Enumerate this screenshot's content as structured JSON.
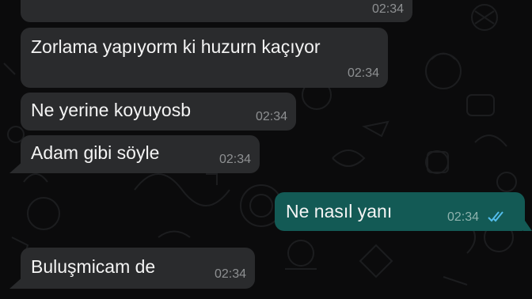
{
  "messages": [
    {
      "direction": "incoming",
      "text": "",
      "time": "02:34"
    },
    {
      "direction": "incoming",
      "text": "Zorlama yapıyorm ki huzurn kaçıyor",
      "time": "02:34"
    },
    {
      "direction": "incoming",
      "text": "Ne yerine koyuyosb",
      "time": "02:34"
    },
    {
      "direction": "incoming",
      "text": "Adam gibi söyle",
      "time": "02:34"
    },
    {
      "direction": "outgoing",
      "text": "Ne  nasıl yanı",
      "time": "02:34",
      "status": "read-double-check-icon"
    },
    {
      "direction": "incoming",
      "text": "Buluşmicam de",
      "time": "02:34"
    }
  ],
  "colors": {
    "background": "#0b0b0c",
    "incoming_bubble": "#2a2b2d",
    "outgoing_bubble": "#135a55",
    "read_ticks": "#53bdeb"
  }
}
